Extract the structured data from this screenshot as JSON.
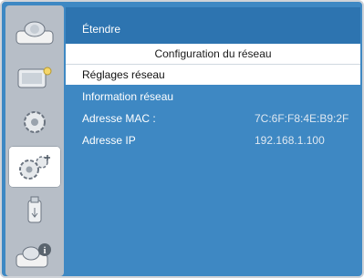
{
  "sidebar": {
    "items": [
      {
        "name": "image-settings-icon"
      },
      {
        "name": "display-settings-icon"
      },
      {
        "name": "setup-gear-icon"
      },
      {
        "name": "extend-gears-icon"
      },
      {
        "name": "usb-media-icon"
      },
      {
        "name": "info-icon"
      }
    ],
    "active_index": 3
  },
  "panel": {
    "title": "Étendre",
    "section": "Configuration du réseau",
    "items": [
      {
        "label": "Réglages réseau",
        "value": "",
        "selected": true
      },
      {
        "label": "Information réseau",
        "value": "",
        "selected": false
      },
      {
        "label": "Adresse  MAC :",
        "value": "7C:6F:F8:4E:B9:2F",
        "selected": false
      },
      {
        "label": "Adresse IP",
        "value": "192.168.1.100",
        "selected": false
      }
    ]
  },
  "colors": {
    "background_blue": "#3e88c3",
    "title_blue": "#2d74b0",
    "sidebar_gray": "#b7bec7",
    "highlight": "#ffffff"
  }
}
